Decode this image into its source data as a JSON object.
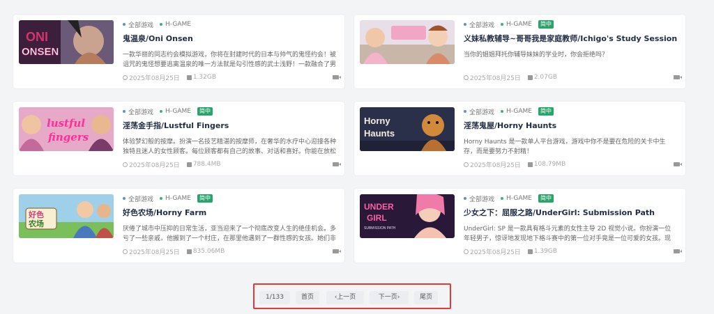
{
  "cards": [
    {
      "cat": "全部游戏",
      "genre": "H-GAME",
      "badge": "",
      "title": "鬼温泉/Oni Onsen",
      "desc": "一款华丽的同志约会模拟游戏，你将在封建时代的日本与帅气的鬼怪约会！被诅咒的鬼怪想要逃离温泉的唯一方法就是勾引性感的武士浅野！一款融合了男同、男…",
      "date": "2025年08月25日",
      "size": "1.32GB"
    },
    {
      "cat": "全部游戏",
      "genre": "H-GAME",
      "badge": "简中",
      "title": "义妹私教辅导~哥哥我是家庭教师/Ichigo's Study Sessions",
      "desc": "当你的姐姐拜托你辅导妹妹的学业时，你会拒绝吗？",
      "date": "2025年08月25日",
      "size": "2.07GB"
    },
    {
      "cat": "全部游戏",
      "genre": "H-GAME",
      "badge": "简中",
      "title": "淫荡金手指/Lustful Fingers",
      "desc": "体验梦幻般的按摩。扮演一名技艺精湛的按摩师，在奢华的水疗中心迎接各种独特且迷人的女性顾客。每位顾客都有自己的故事、对话和喜好。你能在放松她们身…",
      "date": "2025年08月25日",
      "size": "788.4MB"
    },
    {
      "cat": "全部游戏",
      "genre": "H-GAME",
      "badge": "简中",
      "title": "淫荡鬼屋/Horny Haunts",
      "desc": "Horny Haunts 是一款单人平台游戏，游戏中你不是要在危险的关卡中生存，而是要努力不射精！",
      "date": "2025年08月25日",
      "size": "108.79MB"
    },
    {
      "cat": "全部游戏",
      "genre": "H-GAME",
      "badge": "简中",
      "title": "好色农场/Horny Farm",
      "desc": "厌倦了城市中压抑的日常生活，亚当迎来了一个彻底改变人生的绝佳机会。多亏了一些亲戚，他搬到了一个村庄，在那里他遇到了一群性感的女孩。她们非常乐意…",
      "date": "2025年08月25日",
      "size": "835.06MB"
    },
    {
      "cat": "全部游戏",
      "genre": "H-GAME",
      "badge": "简中",
      "title": "少女之下：屈服之路/UnderGirl: Submission Path",
      "desc": "UnderGirl: SP 是一款具有格斗元素的女性主导 2D 视觉小说。你扮演一位年轻男子，惊讶地发现地下格斗赛中的第一位对手竟是一位可爱的女孩。现在，你面前…",
      "date": "2025年08月25日",
      "size": "1.39GB"
    }
  ],
  "pager": {
    "page": "1/133",
    "first": "首页",
    "prev": "上一页",
    "next": "下一页",
    "last": "尾页"
  },
  "thumb_text": [
    "ONI",
    "ONSEN",
    "lustful",
    "fingers",
    "Horny",
    "Haunts",
    "好色",
    "农场",
    "UNDER",
    "GIRL",
    "SUBMISSION PATH"
  ]
}
